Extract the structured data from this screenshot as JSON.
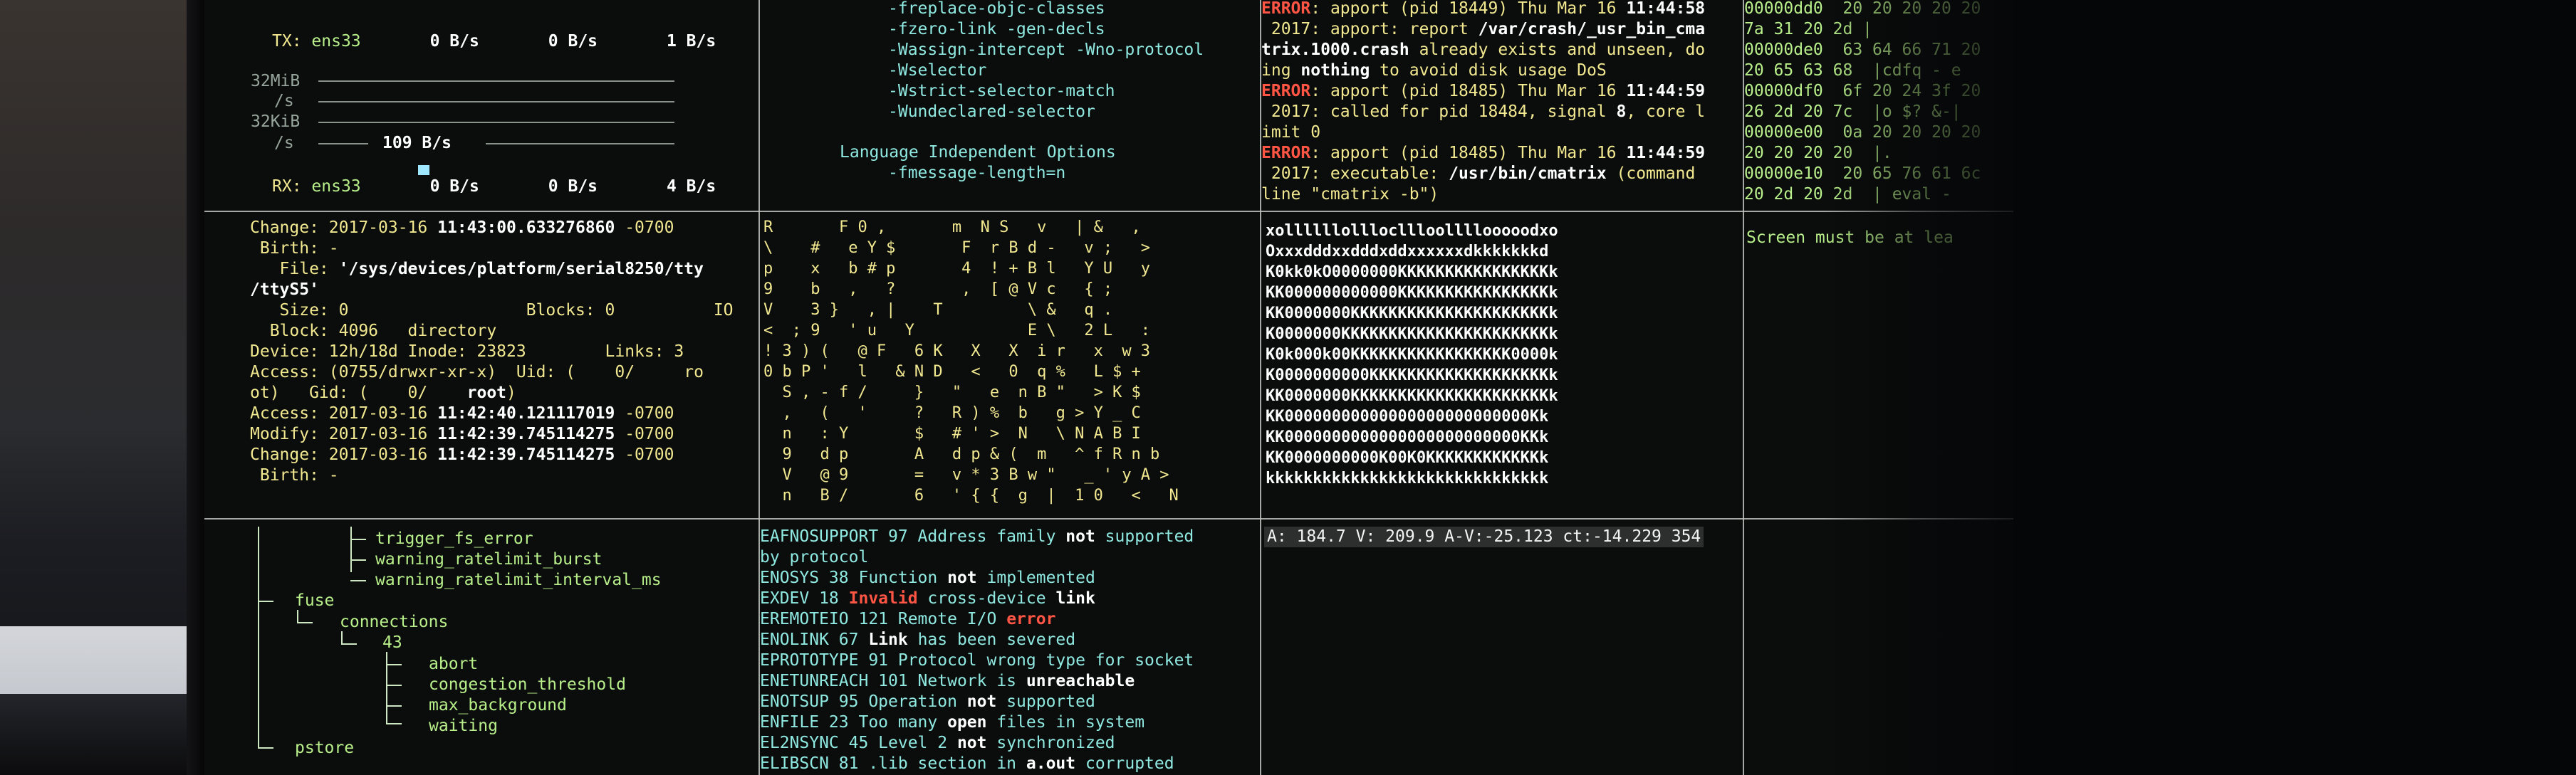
{
  "network": {
    "tx": {
      "label": "TX:",
      "iface": "ens33",
      "v1": "0 B/s",
      "v2": "0 B/s",
      "v3": "1 B/s"
    },
    "scale": [
      "32MiB",
      "/s",
      "32KiB",
      "/s"
    ],
    "rate": "109 B/s",
    "rx": {
      "label": "RX:",
      "iface": "ens33",
      "v1": "0 B/s",
      "v2": "0 B/s",
      "v3": "4 B/s"
    }
  },
  "gcc_flags": {
    "lines": [
      "-freplace-objc-classes",
      "-fzero-link -gen-decls",
      "-Wassign-intercept -Wno-protocol",
      "-Wselector",
      "-Wstrict-selector-match",
      "-Wundeclared-selector"
    ],
    "heading": "Language Independent Options",
    "last": "-fmessage-length=n"
  },
  "syslog": {
    "entries": [
      {
        "tag": "ERROR",
        "head": ": apport (pid 18449) Thu Mar 16 ",
        "time": "11:44:58",
        "l2a": " 2017: apport: report ",
        "l2b": "/var/crash/_usr_bin_cma",
        "l3a": "trix.1000.crash",
        "l3b": " already exists and unseen, do",
        "l4a": "ing ",
        "l4b": "nothing",
        "l4c": " to avoid disk usage DoS"
      },
      {
        "tag": "ERROR",
        "head": ": apport (pid 18485) Thu Mar 16 ",
        "time": "11:44:59",
        "l2a": " 2017: called for pid 18484, signal ",
        "l2b": "8",
        "l2c": ", core l",
        "l3": "imit 0"
      },
      {
        "tag": "ERROR",
        "head": ": apport (pid 18485) Thu Mar 16 ",
        "time": "11:44:59",
        "l2a": " 2017: executable: ",
        "l2b": "/usr/bin/cmatrix",
        "l2c": " (command",
        "l3": "line \"cmatrix -b\")"
      }
    ]
  },
  "hexdump": {
    "rows": [
      "00000dd0  20 20 20 20 20",
      "7a 31 20 2d |     ",
      "00000de0  63 64 66 71 20",
      "20 65 63 68  |cdfq - e",
      "00000df0  6f 20 24 3f 20",
      "26 2d 20 7c  |o $? &-|",
      "00000e00  0a 20 20 20 20",
      "20 20 20 20  |.    ",
      "00000e10  20 65 76 61 6c",
      "20 2d 20 2d  | eval -"
    ]
  },
  "stat": {
    "change_top": {
      "label": "Change: ",
      "date": "2017-03-16 ",
      "time": "11:43:00.633276860",
      "tz": " -0700"
    },
    "birth_top": " Birth: -",
    "file_label": "   File: ",
    "file_path": "'/sys/devices/platform/serial8250/tty",
    "file_path2": "/ttyS5'",
    "size": "   Size: 0                  Blocks: 0          IO",
    "block": "  Block: 4096   directory",
    "device": "Device: 12h/18d Inode: 23823        Links: 3",
    "access_perm": "Access: (0755/drwxr-xr-x)  Uid: (    0/     ro",
    "gid": "ot)   Gid: (    0/    ",
    "gid_name": "root",
    "gid_end": ")",
    "access": {
      "label": "Access: ",
      "date": "2017-03-16 ",
      "time": "11:42:40.121117019",
      "tz": " -0700"
    },
    "modify": {
      "label": "Modify: ",
      "date": "2017-03-16 ",
      "time": "11:42:39.745114275",
      "tz": " -0700"
    },
    "change": {
      "label": "Change: ",
      "date": "2017-03-16 ",
      "time": "11:42:39.745114275",
      "tz": " -0700"
    },
    "birth": " Birth: -"
  },
  "matrix": {
    "rows": [
      "R       F 0 ,       m  N S   v   | &   ,",
      "\\    #   e Y $       F  r B d -   v ;   >",
      "p    x   b # p       4  ! + B l   Y U   y",
      "9    b   ,   ?       ,  [ @ V c   { ;",
      "V    3 }   , |    T         \\ &   q .",
      "<  ; 9   ' u   Y            E \\   2 L   :",
      "! 3 ) (   @ F   6 K   X   X  i r   x  w 3",
      "0 b P '   l   & N D   <   0  q %   L $ +",
      "  S , - f /     }   \"   e  n B \"   > K $",
      "  ,   (   '     ?   R ) %  b   g > Y _ C",
      "  n   : Y       $   # ' >  N   \\ N A B I",
      "  9   d p       A   d p & (  m   ^ f R n b",
      "  V   @ 9       =   v * 3 B w \"   _ ' y A >",
      "  n   B /       6   ' { {  g  |  1 0   <   N"
    ]
  },
  "cowsay": {
    "rows": [
      "xollllllolllocllloollllooooodxo",
      "Oxxxdddxxdddxddxxxxxxdkkkkkkkd",
      "K0kk0kO0000000KKKKKKKKKKKKKKKKk",
      "KK000000000000KKKKKKKKKKKKKKKKk",
      "KK0000000KKKKKKKKKKKKKKKKKKKKKk",
      "K0000000KKKKKKKKKKKKKKKKKKKKKKk",
      "K0k000k00KKKKKKKKKKKKKKKKK0000k",
      "K0000000000KKKKKKKKKKKKKKKKKKKk",
      "KK0000000KKKKKKKKKKKKKKKKKKKKKk",
      "KK00000000000000000000000000Kk",
      "KK0000000000000000000000000KKk",
      "KK0000000000K00K0KKKKKKKKKKKKk",
      "kkkkkkkkkkkkkkkkkkkkkkkkkkkkkk"
    ]
  },
  "screen_msg": "Screen must be at lea",
  "tree": {
    "items": [
      "trigger_fs_error",
      "warning_ratelimit_burst",
      "warning_ratelimit_interval_ms"
    ],
    "fuse": "fuse",
    "connections": "connections",
    "num": "43",
    "sub": [
      "abort",
      "congestion_threshold",
      "max_background",
      "waiting"
    ],
    "pstore": "pstore"
  },
  "errno": {
    "lines": [
      {
        "a": "EAFNOSUPPORT 97 Address family ",
        "b": "not",
        "c": " supported"
      },
      {
        "a": "by protocol"
      },
      {
        "a": "ENOSYS 38 Function ",
        "b": "not",
        "c": " implemented"
      },
      {
        "a": "EXDEV 18 ",
        "r": "Invalid",
        "c": " cross-device ",
        "b2": "link"
      },
      {
        "a": "EREMOTEIO 121 Remote I/O ",
        "r": "error"
      },
      {
        "a": "ENOLINK 67 ",
        "b": "Link",
        "c": " has been severed"
      },
      {
        "a": "EPROTOTYPE 91 Protocol wrong type for socket"
      },
      {
        "a": "ENETUNREACH 101 Network is ",
        "b": "unreachable"
      },
      {
        "a": "ENOTSUP 95 Operation ",
        "b": "not",
        "c": " supported"
      },
      {
        "a": "ENFILE 23 Too many ",
        "b": "open",
        "c": " files in system"
      },
      {
        "a": "EL2NSYNC 45 Level 2 ",
        "b": "not",
        "c": " synchronized"
      },
      {
        "a": "ELIBSCN 81 .lib section in ",
        "b": "a.out",
        "c": " corrupted"
      }
    ]
  },
  "player_status": "A: 184.7 V: 209.9 A-V:-25.123 ct:-14.229 354",
  "colors": {
    "green": "#b8ef8a",
    "yellow": "#f1e890",
    "cyan": "#8fe9e1",
    "red": "#ff5544",
    "white": "#ffffff"
  }
}
